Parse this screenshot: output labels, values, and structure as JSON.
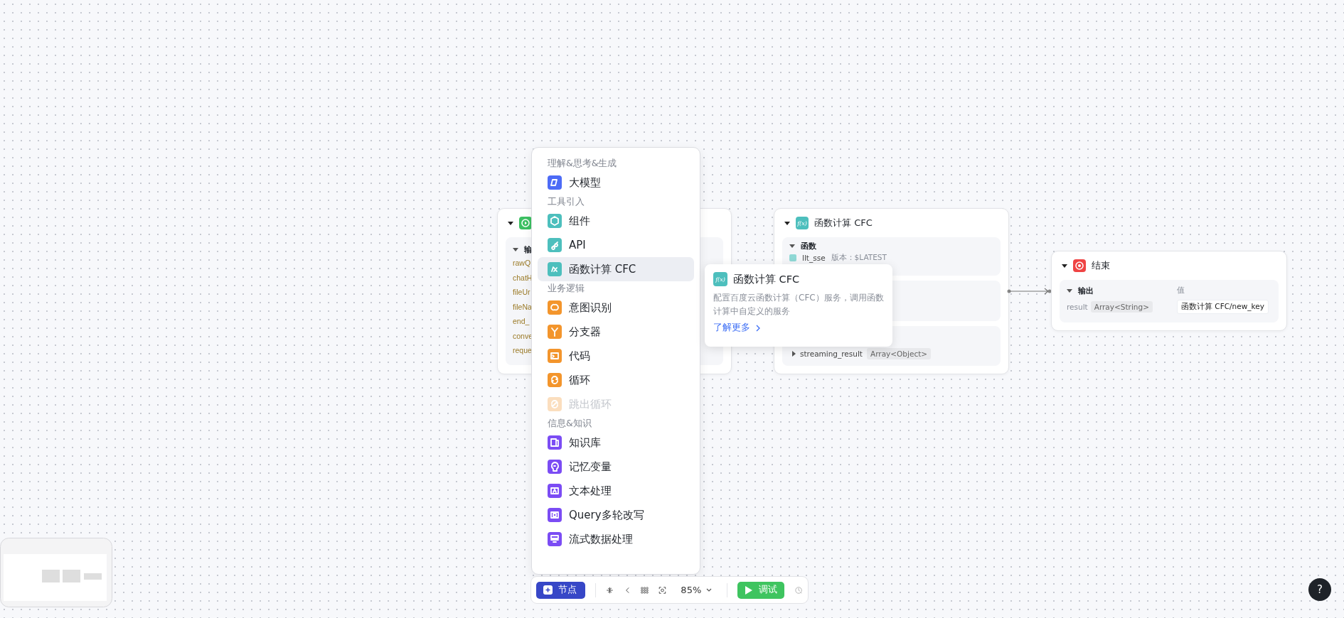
{
  "canvas": {
    "start_node": {
      "expanded": true,
      "section_title": "输",
      "section_expanded": true,
      "variables": [
        "rawQ",
        "chatH",
        "fileUr",
        "fileNa",
        "end_",
        "conve",
        "reque"
      ]
    },
    "cfc_node": {
      "icon_label": "f(x)",
      "title": "函数计算 CFC",
      "expanded": true,
      "function_section": {
        "title": "函数",
        "expanded": true,
        "function_name": "llt_sse",
        "version": "版本：$LATEST"
      },
      "output_row": {
        "name": "streaming_result",
        "type": "Array<Object>",
        "expanded": false
      }
    },
    "end_node": {
      "title": "结束",
      "expanded": true,
      "section_title": "输出",
      "section_expanded": true,
      "value_header": "值",
      "rows": [
        {
          "name": "result",
          "type": "Array<String>",
          "value": "函数计算 CFC/new_key"
        }
      ]
    }
  },
  "node_menu": {
    "groups": [
      {
        "title": "理解&思考&生成",
        "color": "#4d6bf6",
        "items": [
          {
            "label": "大模型",
            "selected": false,
            "disabled": false
          }
        ]
      },
      {
        "title": "工具引入",
        "color": "#4dbfbd",
        "items": [
          {
            "label": "组件",
            "selected": false,
            "disabled": false
          },
          {
            "label": "API",
            "selected": false,
            "disabled": false
          },
          {
            "label": "函数计算 CFC",
            "selected": true,
            "disabled": false
          }
        ]
      },
      {
        "title": "业务逻辑",
        "color": "#f3952c",
        "items": [
          {
            "label": "意图识别",
            "selected": false,
            "disabled": false
          },
          {
            "label": "分支器",
            "selected": false,
            "disabled": false
          },
          {
            "label": "代码",
            "selected": false,
            "disabled": false
          },
          {
            "label": "循环",
            "selected": false,
            "disabled": false
          },
          {
            "label": "跳出循环",
            "selected": false,
            "disabled": true
          }
        ]
      },
      {
        "title": "信息&知识",
        "color": "#7b4cf4",
        "items": [
          {
            "label": "知识库",
            "selected": false,
            "disabled": false
          },
          {
            "label": "记忆变量",
            "selected": false,
            "disabled": false
          },
          {
            "label": "文本处理",
            "selected": false,
            "disabled": false
          },
          {
            "label": "Query多轮改写",
            "selected": false,
            "disabled": false
          },
          {
            "label": "流式数据处理",
            "selected": false,
            "disabled": false
          }
        ]
      }
    ]
  },
  "tooltip": {
    "title": "函数计算 CFC",
    "description": "配置百度云函数计算（CFC）服务，调用函数计算中自定义的服务",
    "link": "了解更多"
  },
  "tooltip_icon_label": "f(x)",
  "toolbar": {
    "add_button": "节点",
    "zoom": "85%",
    "debug_button": "调试"
  },
  "help_button": "?"
}
